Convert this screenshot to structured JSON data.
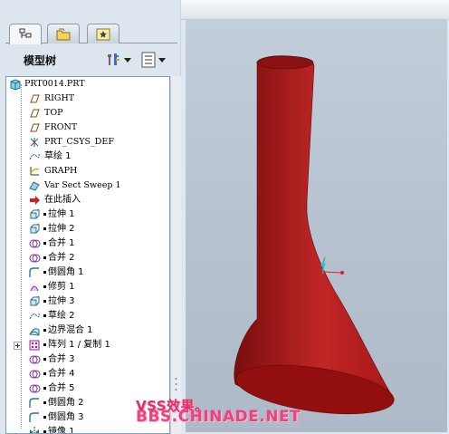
{
  "navigator": {
    "tabs": [
      {
        "name": "model-tree",
        "icon": "tree-icon"
      },
      {
        "name": "folder-browser",
        "icon": "folder-icon"
      },
      {
        "name": "favorites",
        "icon": "star-icon"
      }
    ],
    "tree_title": "模型树",
    "settings_icon": "tools-icon",
    "show_icon": "list-icon"
  },
  "tree": {
    "root": "PRT0014.PRT",
    "items": [
      {
        "label": "RIGHT",
        "icon": "datum-plane-icon",
        "mono": true
      },
      {
        "label": "TOP",
        "icon": "datum-plane-icon",
        "mono": true
      },
      {
        "label": "FRONT",
        "icon": "datum-plane-icon",
        "mono": true
      },
      {
        "label": "PRT_CSYS_DEF",
        "icon": "csys-icon",
        "mono": true
      },
      {
        "label": "草绘 1",
        "icon": "sketch-icon"
      },
      {
        "label": "GRAPH",
        "icon": "graph-icon",
        "mono": true
      },
      {
        "label": "Var Sect Sweep 1",
        "icon": "sweep-icon",
        "mono": true
      },
      {
        "label": "在此插入",
        "icon": "insert-here-icon"
      },
      {
        "label": "拉伸 1",
        "icon": "extrude-icon",
        "mark": true
      },
      {
        "label": "拉伸 2",
        "icon": "extrude-icon",
        "mark": true
      },
      {
        "label": "合并 1",
        "icon": "merge-icon",
        "mark": true
      },
      {
        "label": "合并 2",
        "icon": "merge-icon",
        "mark": true
      },
      {
        "label": "倒圆角 1",
        "icon": "round-icon",
        "mark": true
      },
      {
        "label": "修剪 1",
        "icon": "trim-icon",
        "mark": true
      },
      {
        "label": "拉伸 3",
        "icon": "extrude-icon",
        "mark": true
      },
      {
        "label": "草绘 2",
        "icon": "sketch-icon",
        "mark": true
      },
      {
        "label": "边界混合 1",
        "icon": "boundary-blend-icon",
        "mark": true
      },
      {
        "label": "阵列 1 / 复制 1",
        "icon": "pattern-icon",
        "mark": true,
        "expandable": true
      },
      {
        "label": "合并 3",
        "icon": "merge-icon",
        "mark": true
      },
      {
        "label": "合并 4",
        "icon": "merge-icon",
        "mark": true
      },
      {
        "label": "合并 5",
        "icon": "merge-icon",
        "mark": true
      },
      {
        "label": "倒圆角 2",
        "icon": "round-icon",
        "mark": true
      },
      {
        "label": "倒圆角 3",
        "icon": "round-icon",
        "mark": true
      },
      {
        "label": "镜像 1",
        "icon": "mirror-icon",
        "mark": true
      }
    ]
  },
  "viewport": {
    "model_color": "#a81818",
    "model_highlight": "#c02626",
    "model_shadow": "#7a0d0d"
  },
  "watermark": {
    "line1": "VSS效果。",
    "line2": "BBS.CHINADE.NET"
  }
}
